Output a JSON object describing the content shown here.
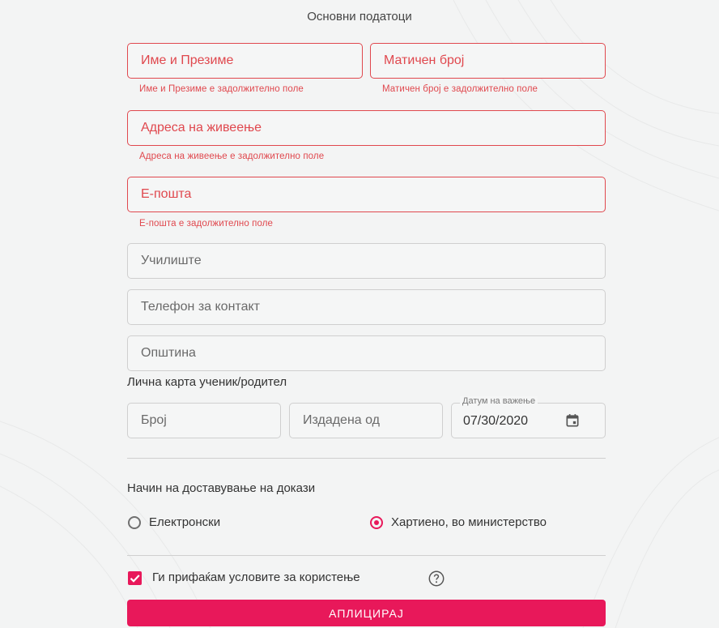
{
  "section_title": "Основни податоци",
  "fields": {
    "full_name": {
      "placeholder": "Име и Презиме",
      "error": "Име и Презиме е задолжително поле"
    },
    "id_number": {
      "placeholder": "Матичен број",
      "error": "Матичен број е задолжително поле"
    },
    "address": {
      "placeholder": "Адреса на живеење",
      "error": "Адреса на живеење е задолжително поле"
    },
    "email": {
      "placeholder": "Е-пошта",
      "error": "Е-пошта е задолжително поле"
    },
    "school": {
      "placeholder": "Училиште"
    },
    "phone": {
      "placeholder": "Телефон за контакт"
    },
    "municipality": {
      "placeholder": "Општина"
    }
  },
  "id_card": {
    "heading": "Лична карта ученик/родител",
    "number_placeholder": "Број",
    "issued_by_placeholder": "Издадена од",
    "validity_label": "Датум на важење",
    "validity_value": "07/30/2020"
  },
  "delivery": {
    "heading": "Начин на доставување на докази",
    "options": [
      {
        "label": "Електронски",
        "checked": false
      },
      {
        "label": "Хартиено, во министерство",
        "checked": true
      }
    ]
  },
  "terms": {
    "label": "Ги прифаќам условите за користење",
    "checked": true
  },
  "apply_label": "АПЛИЦИРАЈ",
  "colors": {
    "accent": "#e8185a",
    "error": "#e0484e",
    "border": "#cfcfcf"
  },
  "icons": [
    "calendar-icon",
    "check-icon",
    "help-circle-icon"
  ]
}
